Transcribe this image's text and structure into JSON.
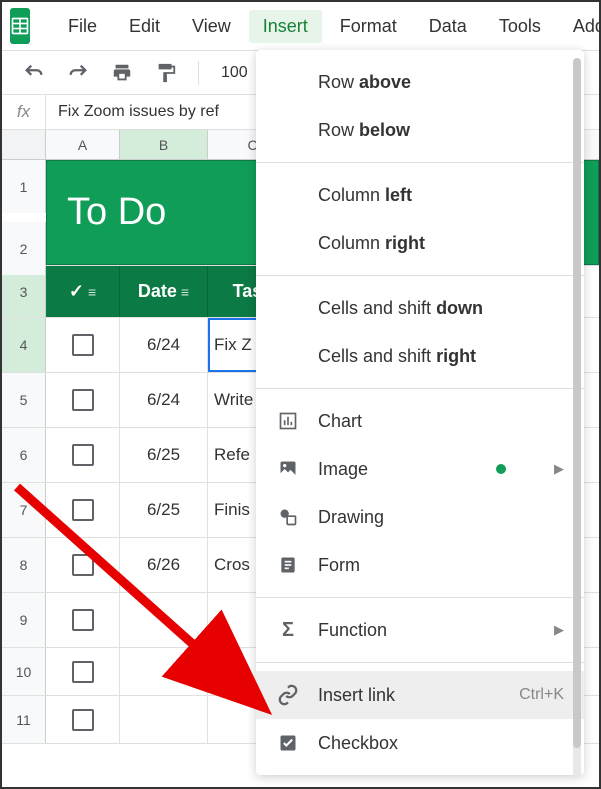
{
  "menubar": {
    "items": [
      "File",
      "Edit",
      "View",
      "Insert",
      "Format",
      "Data",
      "Tools",
      "Add"
    ]
  },
  "toolbar": {
    "zoom": "100"
  },
  "formula_bar": {
    "fx": "fx",
    "value": "Fix Zoom issues by ref"
  },
  "columns": [
    "A",
    "B",
    "C"
  ],
  "title": "To Do",
  "table_headers": {
    "date": "Date",
    "task": "Task"
  },
  "rows": [
    {
      "num": "1"
    },
    {
      "num": "2"
    },
    {
      "num": "3"
    },
    {
      "num": "4",
      "date": "6/24",
      "task": "Fix Z"
    },
    {
      "num": "5",
      "date": "6/24",
      "task": "Write"
    },
    {
      "num": "6",
      "date": "6/25",
      "task": "Refe"
    },
    {
      "num": "7",
      "date": "6/25",
      "task": "Finis"
    },
    {
      "num": "8",
      "date": "6/26",
      "task": "Cros"
    },
    {
      "num": "9",
      "date": "",
      "task": ""
    },
    {
      "num": "10",
      "date": "",
      "task": ""
    },
    {
      "num": "11",
      "date": "",
      "task": ""
    }
  ],
  "dropdown": {
    "row_above": {
      "prefix": "Row ",
      "bold": "above"
    },
    "row_below": {
      "prefix": "Row ",
      "bold": "below"
    },
    "col_left": {
      "prefix": "Column ",
      "bold": "left"
    },
    "col_right": {
      "prefix": "Column ",
      "bold": "right"
    },
    "cells_down": {
      "prefix": "Cells and shift ",
      "bold": "down"
    },
    "cells_right": {
      "prefix": "Cells and shift ",
      "bold": "right"
    },
    "chart": "Chart",
    "image": "Image",
    "drawing": "Drawing",
    "form": "Form",
    "function": "Function",
    "insert_link": "Insert link",
    "insert_link_shortcut": "Ctrl+K",
    "checkbox": "Checkbox"
  }
}
